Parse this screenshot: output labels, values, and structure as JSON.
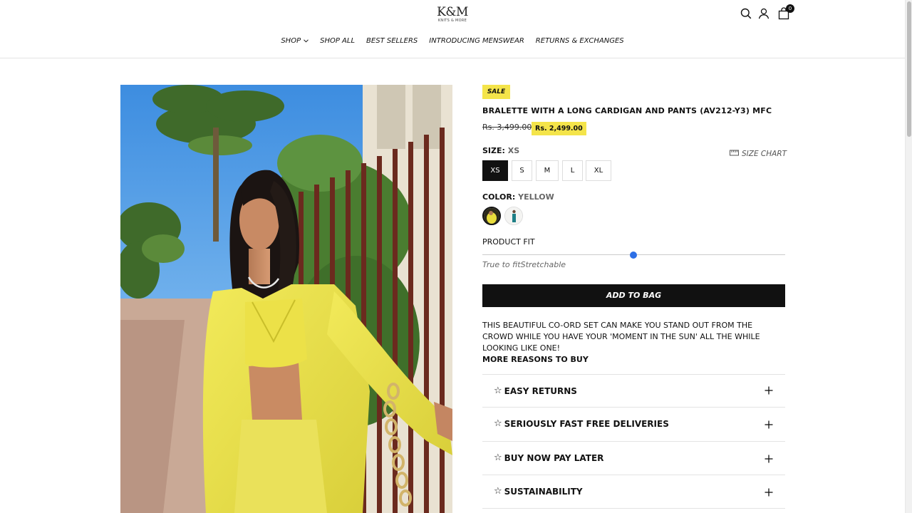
{
  "brand": {
    "logo_main": "K&M",
    "logo_sub": "KNITS & MORE"
  },
  "header": {
    "cart_count": "0",
    "icons": [
      "search-icon",
      "account-icon",
      "bag-icon"
    ]
  },
  "nav": {
    "items": [
      {
        "label": "SHOP"
      },
      {
        "label": "SHOP ALL"
      },
      {
        "label": "BEST SELLERS"
      },
      {
        "label": "INTRODUCING MENSWEAR"
      },
      {
        "label": "RETURNS & EXCHANGES"
      }
    ]
  },
  "product": {
    "badge": "SALE",
    "title": "BRALETTE WITH A LONG CARDIGAN AND PANTS (AV212-Y3) MFC",
    "old_price": "Rs. 3,499.00",
    "new_price": "Rs. 2,499.00",
    "size_label": "SIZE:",
    "size_value": "XS",
    "size_chart": "SIZE CHART",
    "sizes": [
      "XS",
      "S",
      "M",
      "L",
      "XL"
    ],
    "color_label": "COLOR:",
    "color_value": "YELLOW",
    "fit_label": "PRODUCT FIT",
    "fit_level": 0.5,
    "fit_text": "True to fitStretchable",
    "add_to_bag": "ADD TO BAG",
    "description": "THIS BEAUTIFUL CO-ORD SET CAN MAKE YOU STAND OUT FROM THE CROWD WHILE YOU HAVE YOUR 'MOMENT IN THE SUN' ALL THE WHILE LOOKING LIKE ONE!",
    "more_reasons": "MORE REASONS TO BUY",
    "accordion": [
      {
        "label": "EASY RETURNS"
      },
      {
        "label": "SERIOUSLY FAST FREE DELIVERIES"
      },
      {
        "label": "BUY NOW PAY LATER"
      },
      {
        "label": "SUSTAINABILITY"
      }
    ]
  },
  "colors": {
    "accent_yellow": "#f4e44a",
    "fit_dot": "#2d6fe6",
    "black": "#111111"
  }
}
